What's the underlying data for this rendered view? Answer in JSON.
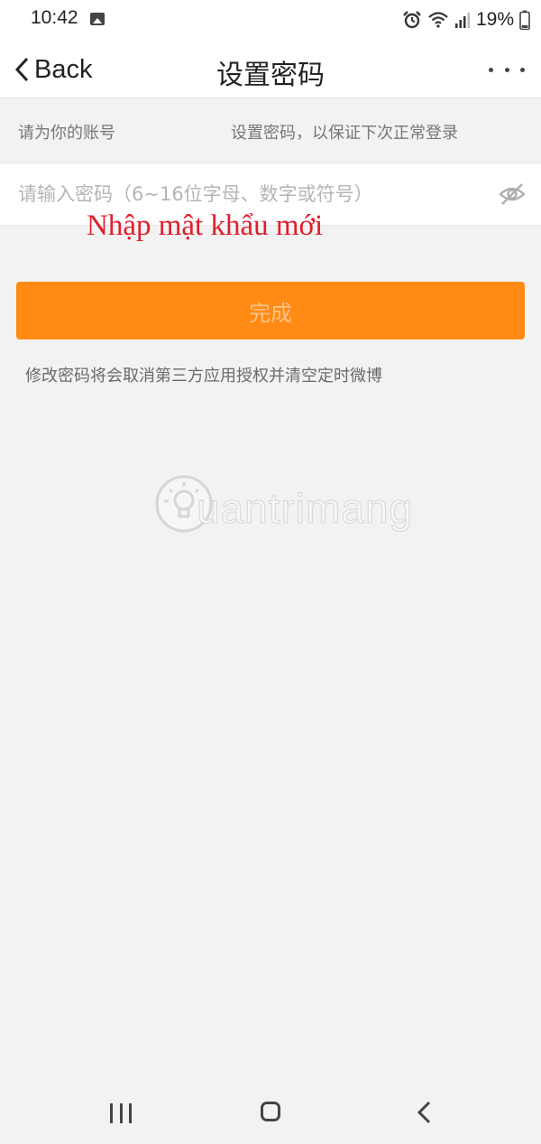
{
  "status_bar": {
    "time": "10:42",
    "battery_percent": "19%",
    "icons": [
      "gallery-icon",
      "alarm-icon",
      "wifi-icon",
      "signal-icon",
      "battery-icon"
    ]
  },
  "header": {
    "back_label": "Back",
    "title": "设置密码",
    "more_icon": "more-dots-icon"
  },
  "hint": {
    "text_start": "请为你的账号",
    "text_end": "设置密码，以保证下次正常登录"
  },
  "password_field": {
    "placeholder": "请输入密码（6~16位字母、数字或符号）",
    "value": "",
    "toggle_icon": "eye-off-icon"
  },
  "annotation": {
    "caption": "Nhập mật khẩu mới",
    "color": "#e01e2b"
  },
  "submit": {
    "label": "完成",
    "color": "#ff8a14"
  },
  "notice": "修改密码将会取消第三方应用授权并清空定时微博",
  "watermark": {
    "text": "uantrimang"
  },
  "bottom_nav": {
    "icons": [
      "recent-apps-icon",
      "home-icon",
      "back-icon"
    ]
  }
}
